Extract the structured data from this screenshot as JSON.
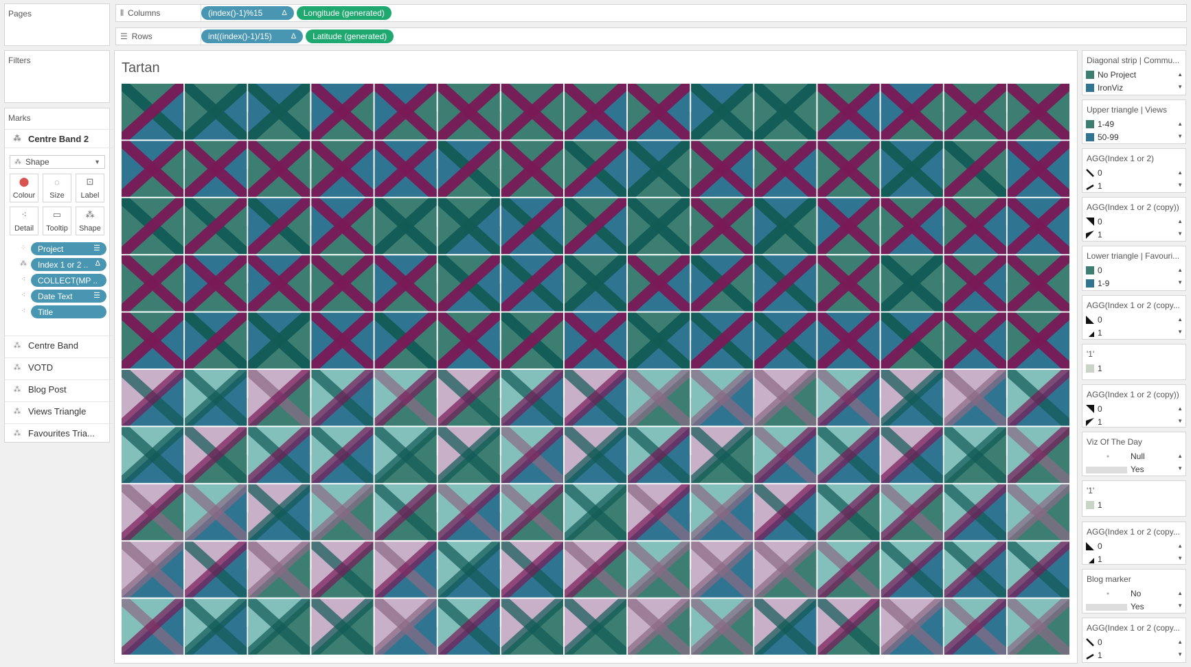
{
  "pages_label": "Pages",
  "filters_label": "Filters",
  "marks_label": "Marks",
  "columns": {
    "label": "Columns",
    "pills": [
      {
        "text": "(index()-1)%15",
        "delta": "Δ",
        "color": "blue"
      },
      {
        "text": "Longitude (generated)",
        "delta": "",
        "color": "green"
      }
    ]
  },
  "rows": {
    "label": "Rows",
    "pills": [
      {
        "text": "int((index()-1)/15)",
        "delta": "Δ",
        "color": "blue"
      },
      {
        "text": "Latitude (generated)",
        "delta": "",
        "color": "green"
      }
    ]
  },
  "marks": {
    "active_layer": "Centre Band 2",
    "mark_type": "Shape",
    "buttons": [
      "Colour",
      "Size",
      "Label",
      "Detail",
      "Tooltip",
      "Shape"
    ],
    "fields": [
      {
        "text": "Project",
        "icon": "colour-icon",
        "right": "sort-icon"
      },
      {
        "text": "Index 1 or 2 ..",
        "icon": "shape-icon",
        "right": "Δ"
      },
      {
        "text": "COLLECT(MP ..",
        "icon": "detail-icon",
        "right": ""
      },
      {
        "text": "Date Text",
        "icon": "detail-icon",
        "right": "sort-icon"
      },
      {
        "text": "Title",
        "icon": "detail-icon",
        "right": ""
      }
    ],
    "layers": [
      "Centre Band",
      "VOTD",
      "Blog Post",
      "Views Triangle",
      "Favourites Tria..."
    ]
  },
  "viz_title": "Tartan",
  "legends": [
    {
      "title": "Diagonal strip | Commu...",
      "items": [
        {
          "label": "No Project",
          "swatch": "#3c7f72"
        },
        {
          "label": "IronViz",
          "swatch": "#2f7592"
        }
      ]
    },
    {
      "title": "Upper triangle | Views",
      "items": [
        {
          "label": "1-49",
          "swatch": "#3c7f72"
        },
        {
          "label": "50-99",
          "swatch": "#2f7592"
        }
      ]
    },
    {
      "title": "AGG(Index 1 or 2)",
      "items": [
        {
          "label": "0",
          "shape": "diag-down"
        },
        {
          "label": "1",
          "shape": "diag-up"
        }
      ]
    },
    {
      "title": "AGG(Index 1 or 2 (copy))",
      "items": [
        {
          "label": "0",
          "shape": "tri-tr"
        },
        {
          "label": "1",
          "shape": "tri-bl"
        }
      ]
    },
    {
      "title": "Lower triangle | Favouri...",
      "items": [
        {
          "label": "0",
          "swatch": "#3c7f72"
        },
        {
          "label": "1-9",
          "swatch": "#2f7592"
        }
      ]
    },
    {
      "title": "AGG(Index 1 or 2 (copy...",
      "items": [
        {
          "label": "0",
          "shape": "tri-bl2"
        },
        {
          "label": "1",
          "shape": "tri-br"
        }
      ]
    },
    {
      "title": "'1'",
      "items": [
        {
          "label": "1",
          "swatch": "#c9d3c7"
        }
      ]
    },
    {
      "title": "AGG(Index 1 or 2 (copy))",
      "items": [
        {
          "label": "0",
          "shape": "tri-tr"
        },
        {
          "label": "1",
          "shape": "tri-bl"
        }
      ]
    },
    {
      "title": "Viz Of The Day",
      "items": [
        {
          "label": "Null",
          "shape": "dot"
        },
        {
          "label": "Yes",
          "shape": "bar"
        }
      ]
    },
    {
      "title": "'1'",
      "items": [
        {
          "label": "1",
          "swatch": "#c9d3c7"
        }
      ]
    },
    {
      "title": "AGG(Index 1 or 2 (copy...",
      "items": [
        {
          "label": "0",
          "shape": "tri-bl2"
        },
        {
          "label": "1",
          "shape": "tri-br"
        }
      ]
    },
    {
      "title": "Blog marker",
      "items": [
        {
          "label": "No",
          "shape": "dot"
        },
        {
          "label": "Yes",
          "shape": "bar"
        }
      ]
    },
    {
      "title": "AGG(Index 1 or 2 (copy...",
      "items": [
        {
          "label": "0",
          "shape": "diag-down"
        },
        {
          "label": "1",
          "shape": "diag-up"
        }
      ]
    }
  ],
  "colors": {
    "teal": "#3c7f72",
    "blue": "#2f7592",
    "plum": "#7a1a57",
    "light_teal": "#84c0bb",
    "lilac": "#c8b0c8",
    "dark_teal": "#125b56"
  }
}
